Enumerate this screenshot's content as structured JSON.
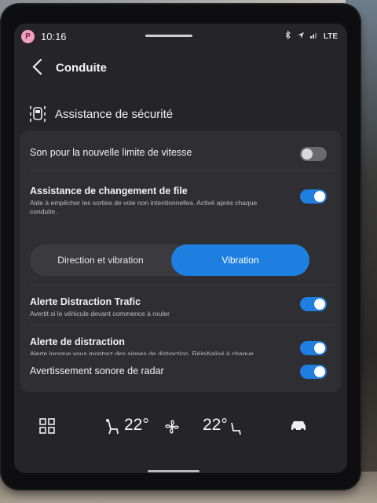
{
  "status_bar": {
    "profile_initial": "P",
    "time": "10:16",
    "network": "LTE"
  },
  "header": {
    "title": "Conduite"
  },
  "section": {
    "title": "Assistance de sécurité",
    "icon": "lane-assist-icon"
  },
  "settings": [
    {
      "label": "Son pour la nouvelle limite de vitesse",
      "description": "",
      "enabled": false
    },
    {
      "label": "Assistance de changement de file",
      "description": "Aide à empêcher les sorties de voie non intentionnelles. Activé après chaque conduite.",
      "enabled": true
    },
    {
      "label": "Alerte Distraction Trafic",
      "description": "Avertit si le véhicule devant commence à rouler",
      "enabled": true
    },
    {
      "label": "Alerte de distraction",
      "description": "Alerte lorsque vous montrez des signes de distraction. Réinitialisé à chaque conduite.",
      "enabled": true
    },
    {
      "label": "Avertissement sonore de radar",
      "description": "",
      "enabled": true
    }
  ],
  "feedback_mode": {
    "options": [
      "Direction et vibration",
      "Vibration"
    ],
    "selected": "Vibration"
  },
  "bottom_bar": {
    "left_temp": "22°",
    "right_temp": "22°",
    "icons": [
      "apps-grid-icon",
      "seat-heat-driver-icon",
      "fan-icon",
      "seat-heat-passenger-icon",
      "car-icon"
    ]
  },
  "colors": {
    "accent": "#1e7fe0",
    "background": "#252528",
    "card": "#2f2f33"
  }
}
